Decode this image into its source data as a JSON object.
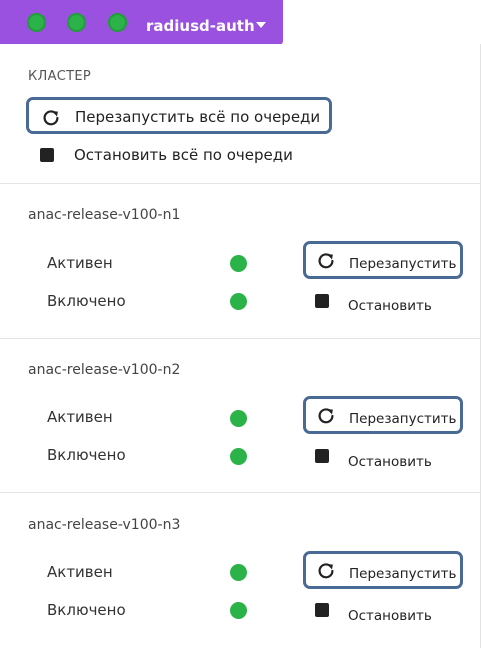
{
  "topbar": {
    "title": "radiusd-auth",
    "status_color": "#2bb34a",
    "bar_color": "#9b51e0",
    "dots": [
      "status-dot-1",
      "status-dot-2",
      "status-dot-3"
    ]
  },
  "cluster": {
    "header": "КЛАСТЕР",
    "restart_all_label": "Перезапустить всё по очереди",
    "stop_all_label": "Остановить всё по очереди"
  },
  "nodes": [
    {
      "name": "anac-release-v100-n1",
      "active_label": "Активен",
      "enabled_label": "Включено",
      "restart_label": "Перезапустить",
      "stop_label": "Остановить"
    },
    {
      "name": "anac-release-v100-n2",
      "active_label": "Активен",
      "enabled_label": "Включено",
      "restart_label": "Перезапустить",
      "stop_label": "Остановить"
    },
    {
      "name": "anac-release-v100-n3",
      "active_label": "Активен",
      "enabled_label": "Включено",
      "restart_label": "Перезапустить",
      "stop_label": "Остановить"
    }
  ],
  "icons": {
    "restart": "restart-icon",
    "stop": "stop-icon",
    "dropdown": "chevron-down-icon"
  },
  "colors": {
    "highlight_border": "#4a6a96",
    "status_ok": "#2bb34a"
  }
}
